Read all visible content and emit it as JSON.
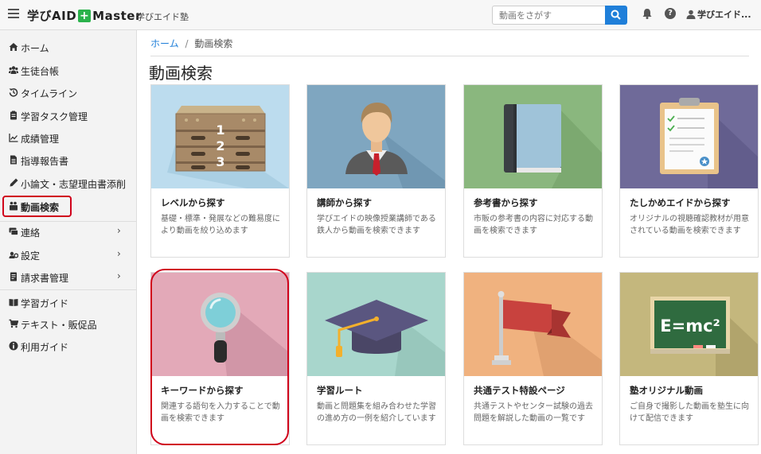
{
  "header": {
    "logo_text": "学びAID",
    "logo_plus": "+",
    "logo_master": "Master",
    "school": "学びエイド塾",
    "search_placeholder": "動画をさがす",
    "help": "?",
    "user": "学びエイド..."
  },
  "sidebar": {
    "items": [
      {
        "label": "ホーム",
        "icon": "home-icon"
      },
      {
        "label": "生徒台帳",
        "icon": "users-icon"
      },
      {
        "label": "タイムライン",
        "icon": "history-icon"
      },
      {
        "label": "学習タスク管理",
        "icon": "clipboard-icon"
      },
      {
        "label": "成績管理",
        "icon": "chart-icon"
      },
      {
        "label": "指導報告書",
        "icon": "file-icon"
      },
      {
        "label": "小論文・志望理由書添削",
        "icon": "pen-icon"
      },
      {
        "label": "動画検索",
        "icon": "video-icon"
      },
      {
        "label": "連絡",
        "icon": "message-icon",
        "chevron": "›"
      },
      {
        "label": "設定",
        "icon": "settings-icon",
        "chevron": "›"
      },
      {
        "label": "請求書管理",
        "icon": "invoice-icon",
        "chevron": "›"
      },
      {
        "label": "学習ガイド",
        "icon": "book-icon"
      },
      {
        "label": "テキスト・販促品",
        "icon": "cart-icon"
      },
      {
        "label": "利用ガイド",
        "icon": "info-icon"
      }
    ]
  },
  "breadcrumb": {
    "home": "ホーム",
    "sep": "/",
    "current": "動画検索"
  },
  "page_title": "動画検索",
  "cards": [
    {
      "title": "レベルから探す",
      "desc": "基礎・標準・発展などの難易度により動画を絞り込めます",
      "bg": "#bcdcee",
      "icon": "level-steps-icon",
      "steps": [
        "1",
        "2",
        "3"
      ]
    },
    {
      "title": "講師から探す",
      "desc": "学びエイドの映像授業講師である鉄人から動画を検索できます",
      "bg": "#7fa6c0",
      "icon": "teacher-icon"
    },
    {
      "title": "参考書から探す",
      "desc": "市販の参考書の内容に対応する動画を検索できます",
      "bg": "#8ab77e",
      "icon": "book-cover-icon"
    },
    {
      "title": "たしかめエイドから探す",
      "desc": "オリジナルの視聴確認教材が用意されている動画を検索できます",
      "bg": "#6f6a99",
      "icon": "checklist-icon"
    },
    {
      "title": "キーワードから探す",
      "desc": "関連する語句を入力することで動画を検索できます",
      "bg": "#e3a9b8",
      "icon": "magnifier-icon"
    },
    {
      "title": "学習ルート",
      "desc": "動画と問題集を組み合わせた学習の進め方の一例を紹介しています",
      "bg": "#a8d6cc",
      "icon": "graduation-cap-icon"
    },
    {
      "title": "共通テスト特設ページ",
      "desc": "共通テストやセンター試験の過去問題を解説した動画の一覧です",
      "bg": "#f0b27f",
      "icon": "flag-icon"
    },
    {
      "title": "塾オリジナル動画",
      "desc": "ご自身で撮影した動画を塾生に向けて配信できます",
      "bg": "#c4b77d",
      "icon": "blackboard-icon",
      "formula": "E=mc²"
    }
  ]
}
